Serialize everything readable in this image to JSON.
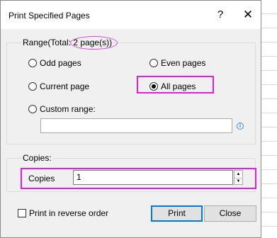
{
  "window": {
    "title": "Print Specified Pages",
    "help_label": "?",
    "close_label": "✕"
  },
  "range": {
    "legend_prefix": "Range(Total: ",
    "total_text": "2 page(s))",
    "options": {
      "odd": "Odd pages",
      "even": "Even pages",
      "current": "Current page",
      "all": "All pages",
      "custom": "Custom range:"
    },
    "selected": "all",
    "custom_value": "",
    "info_icon": "i"
  },
  "copies": {
    "legend": "Copies:",
    "label": "Copies",
    "value": "1",
    "spin_up": "▲",
    "spin_down": "▼"
  },
  "reverse": {
    "label": "Print in reverse order",
    "checked": false
  },
  "buttons": {
    "print": "Print",
    "close": "Close"
  },
  "colors": {
    "annotation": "#e020e0",
    "default_button_border": "#0078d7",
    "info": "#3b8be0"
  }
}
